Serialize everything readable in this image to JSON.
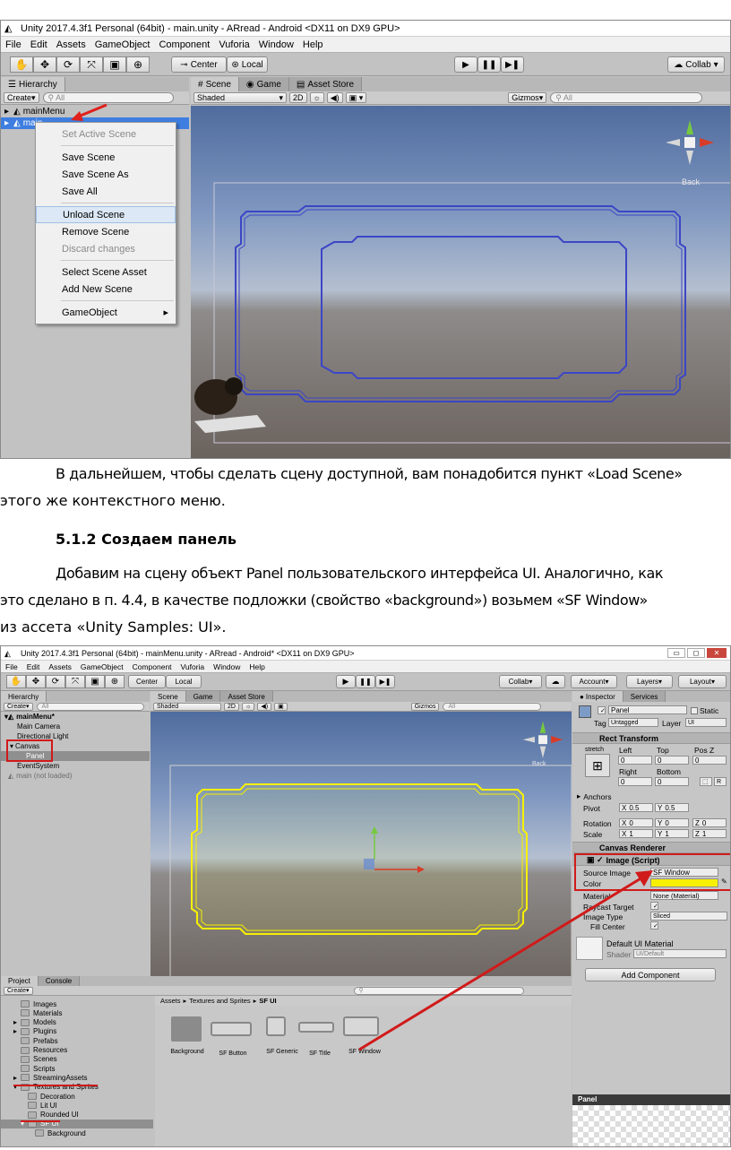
{
  "screenshot1": {
    "title": "Unity 2017.4.3f1 Personal (64bit) - main.unity - ARread - Android <DX11 on DX9 GPU>",
    "menu": [
      "File",
      "Edit",
      "Assets",
      "GameObject",
      "Component",
      "Vuforia",
      "Window",
      "Help"
    ],
    "toolbar": {
      "center": "Center",
      "local": "Local",
      "collab": "Collab"
    },
    "tabs": {
      "hierarchy": "Hierarchy",
      "scene": "Scene",
      "game": "Game",
      "asset_store": "Asset Store"
    },
    "hierarchy": {
      "create": "Create",
      "search": "All",
      "items": [
        "mainMenu",
        "main"
      ]
    },
    "scene_bar": {
      "shaded": "Shaded",
      "mode2d": "2D",
      "gizmos": "Gizmos",
      "search": "All",
      "back": "Back"
    },
    "context_menu": [
      {
        "label": "Set Active Scene",
        "disabled": true
      },
      {
        "sep": true
      },
      {
        "label": "Save Scene"
      },
      {
        "label": "Save Scene As"
      },
      {
        "label": "Save All"
      },
      {
        "sep": true
      },
      {
        "label": "Unload Scene",
        "highlighted": true
      },
      {
        "label": "Remove Scene"
      },
      {
        "label": "Discard changes",
        "disabled": true
      },
      {
        "sep": true
      },
      {
        "label": "Select Scene Asset"
      },
      {
        "label": "Add New Scene"
      },
      {
        "sep": true
      },
      {
        "label": "GameObject",
        "submenu": true
      }
    ]
  },
  "text": {
    "para1_line1": "В дальнейшем, чтобы сделать сцену доступной, вам понадобится пункт «Load Scene»",
    "para1_line2": "этого же контекстного меню.",
    "heading": "5.1.2 Создаем панель",
    "para2_line1": "Добавим на сцену объект Panel пользовательского интерфейса UI. Аналогично, как",
    "para2_line2": "это сделано в п.  4.4, в качестве подложки (свойство «background») возьмем «SF Window»",
    "para2_line3": "из ассета «Unity Samples: UI»."
  },
  "screenshot2": {
    "title": "Unity 2017.4.3f1 Personal (64bit) - mainMenu.unity - ARread - Android* <DX11 on DX9 GPU>",
    "menu": [
      "File",
      "Edit",
      "Assets",
      "GameObject",
      "Component",
      "Vuforia",
      "Window",
      "Help"
    ],
    "toolbar": {
      "center": "Center",
      "local": "Local",
      "collab": "Collab",
      "account": "Account",
      "layers": "Layers",
      "layout": "Layout"
    },
    "tabs": {
      "hierarchy": "Hierarchy",
      "scene": "Scene",
      "game": "Game",
      "asset_store": "Asset Store",
      "inspector": "Inspector",
      "services": "Services",
      "project": "Project",
      "console": "Console"
    },
    "hierarchy": {
      "create": "Create",
      "search": "All",
      "items": [
        "mainMenu*",
        "Main Camera",
        "Directional Light",
        "Canvas",
        "Panel",
        "EventSystem",
        "main (not loaded)"
      ]
    },
    "scene_bar": {
      "shaded": "Shaded",
      "mode2d": "2D",
      "gizmos": "Gizmos",
      "search": "All",
      "back": "Back"
    },
    "inspector": {
      "name": "Panel",
      "static": "Static",
      "tag_label": "Tag",
      "tag": "Untagged",
      "layer_label": "Layer",
      "layer": "UI",
      "rect_transform": "Rect Transform",
      "stretch": "stretch",
      "left": "Left",
      "top": "Top",
      "posz": "Pos Z",
      "left_v": "0",
      "top_v": "0",
      "posz_v": "0",
      "right": "Right",
      "bottom": "Bottom",
      "right_v": "0",
      "bottom_v": "0",
      "r_btn": "R",
      "anchors": "Anchors",
      "pivot": "Pivot",
      "pivot_x": "0.5",
      "pivot_y": "0.5",
      "rotation": "Rotation",
      "rot_x": "0",
      "rot_y": "0",
      "rot_z": "0",
      "scale": "Scale",
      "scale_x": "1",
      "scale_y": "1",
      "scale_z": "1",
      "canvas_renderer": "Canvas Renderer",
      "image_script": "Image (Script)",
      "source_image": "Source Image",
      "source_image_v": "SF Window",
      "color": "Color",
      "color_v": "#f7f000",
      "material": "Material",
      "material_v": "None (Material)",
      "raycast": "Raycast Target",
      "image_type": "Image Type",
      "image_type_v": "Sliced",
      "fill_center": "Fill Center",
      "default_material": "Default UI Material",
      "shader": "Shader",
      "shader_v": "UI/Default",
      "add_component": "Add Component",
      "preview": "Panel"
    },
    "project": {
      "create": "Create",
      "folders": [
        "Images",
        "Materials",
        "Models",
        "Plugins",
        "Prefabs",
        "Resources",
        "Scenes",
        "Scripts",
        "StreamingAssets",
        "Textures and Sprites",
        "Decoration",
        "Lit UI",
        "Rounded UI",
        "SF UI",
        "Background"
      ],
      "breadcrumb": [
        "Assets",
        "Textures and Sprites",
        "SF UI"
      ],
      "assets": [
        "Background",
        "SF Button",
        "SF Generic",
        "SF Title",
        "SF Window"
      ]
    }
  }
}
